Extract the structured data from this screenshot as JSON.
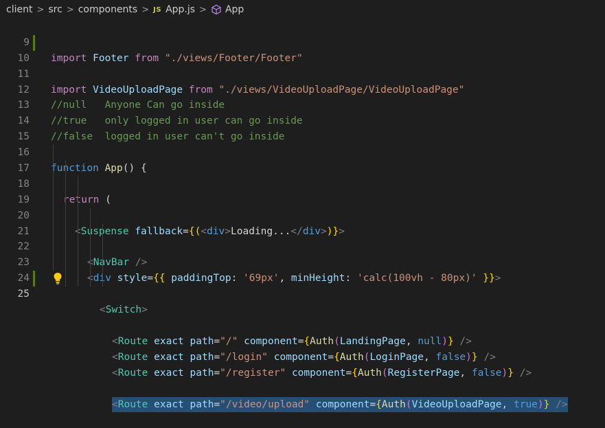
{
  "breadcrumb": {
    "items": [
      "client",
      "src",
      "components",
      "App.js",
      "App"
    ],
    "separator": ">",
    "js_badge": "JS"
  },
  "editor": {
    "active_line": 25,
    "lines": [
      {
        "n": "9"
      },
      {
        "n": "10"
      },
      {
        "n": "11"
      },
      {
        "n": "12"
      },
      {
        "n": "13"
      },
      {
        "n": "14"
      },
      {
        "n": "15"
      },
      {
        "n": "16"
      },
      {
        "n": "17"
      },
      {
        "n": "18"
      },
      {
        "n": "19"
      },
      {
        "n": "20"
      },
      {
        "n": "21"
      },
      {
        "n": "22"
      },
      {
        "n": "23"
      },
      {
        "n": "24"
      },
      {
        "n": "25"
      }
    ],
    "tokens": {
      "l9": [
        "import",
        " Footer ",
        "from",
        " \"./views/Footer/Footer\""
      ],
      "l10": [
        "import",
        " VideoUploadPage ",
        "from",
        " \"./views/VideoUploadPage/VideoUploadPage\""
      ],
      "l12": "//null   Anyone Can go inside",
      "l13": "//true   only logged in user can go inside",
      "l14": "//false  logged in user can't go inside",
      "l16": [
        "function",
        " ",
        "App",
        "() {"
      ],
      "l17": [
        "return",
        " ("
      ],
      "l18": [
        "<",
        "Suspense",
        " ",
        "fallback",
        "=",
        "{(",
        "<",
        "div",
        ">",
        "Loading...",
        "</",
        "div",
        ">",
        ")}",
        ">"
      ],
      "l19": [
        "<",
        "NavBar",
        " />"
      ],
      "l20": [
        "<",
        "div",
        " ",
        "style",
        "=",
        "{{",
        " ",
        "paddingTop",
        ": ",
        "'69px'",
        ", ",
        "minHeight",
        ": ",
        "'calc(100vh - 80px)'",
        " ",
        "}}",
        ">"
      ],
      "l21": [
        "<",
        "Switch",
        ">"
      ],
      "l22": [
        "<",
        "Route",
        " ",
        "exact",
        " ",
        "path",
        "=",
        "\"/\"",
        " ",
        "component",
        "=",
        "{",
        "Auth",
        "(",
        "LandingPage",
        ", ",
        "null",
        ")",
        "}",
        " />"
      ],
      "l23": [
        "<",
        "Route",
        " ",
        "exact",
        " ",
        "path",
        "=",
        "\"/login\"",
        " ",
        "component",
        "=",
        "{",
        "Auth",
        "(",
        "LoginPage",
        ", ",
        "false",
        ")",
        "}",
        " />"
      ],
      "l24": [
        "<",
        "Route",
        " ",
        "exact",
        " ",
        "path",
        "=",
        "\"/register\"",
        " ",
        "component",
        "=",
        "{",
        "Auth",
        "(",
        "RegisterPage",
        ", ",
        "false",
        ")",
        "}",
        " />"
      ],
      "l25": [
        "<",
        "Route",
        " ",
        "exact",
        " ",
        "path",
        "=",
        "\"/video/upload\"",
        " ",
        "component",
        "=",
        "{",
        "Auth",
        "(",
        "VideoUploadPage",
        ", ",
        "true",
        ")",
        "}",
        " />"
      ]
    }
  },
  "colors": {
    "background": "#1e1e1e",
    "keyword": "#569cd6",
    "control": "#c586c0",
    "string": "#ce9178",
    "comment": "#6a9955",
    "component": "#4ec9b0",
    "function": "#dcdcaa",
    "property": "#9cdcfe",
    "selection": "#264f78"
  },
  "icons": [
    "js-file-icon",
    "cube-symbol-icon",
    "lightbulb-icon"
  ]
}
